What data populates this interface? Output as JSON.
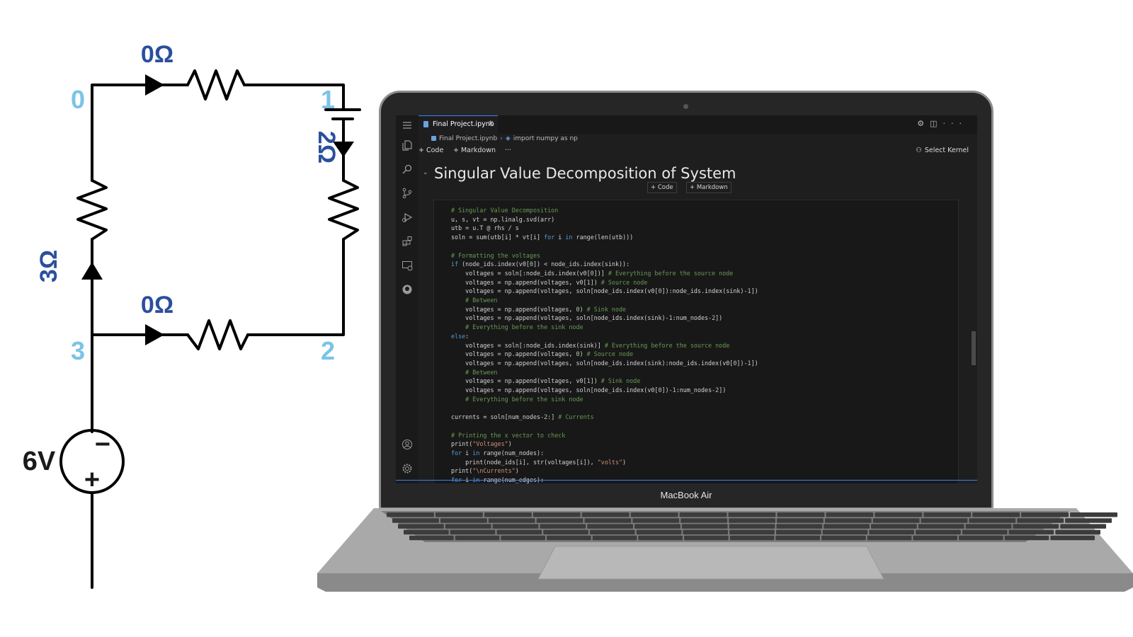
{
  "circuit": {
    "nodes": [
      "0",
      "1",
      "2",
      "3"
    ],
    "resistors": [
      "0Ω",
      "2Ω",
      "0Ω",
      "3Ω"
    ],
    "source": "6V",
    "source_minus": "−",
    "source_plus": "+"
  },
  "laptop": {
    "brand_label": "MacBook Air"
  },
  "editor": {
    "tab": {
      "label": "Final Project.ipynb",
      "close": "×"
    },
    "topright_icons": [
      "gear-icon",
      "split-editor-icon",
      "more-icon"
    ],
    "breadcrumb": {
      "file": "Final Project.ipynb",
      "symbol": "import numpy as np"
    },
    "toolbar": {
      "add_code": "+ Code",
      "add_markdown": "+ Markdown",
      "more": "···",
      "select_kernel": "Select Kernel"
    },
    "markdown_heading": "Singular Value Decomposition of System",
    "cell_toolbar": {
      "code": "+ Code",
      "markdown": "+ Markdown"
    },
    "activity_icons": [
      "menu-icon",
      "explorer-icon",
      "search-icon",
      "source-control-icon",
      "run-debug-icon",
      "extensions-icon",
      "remote-explorer-icon",
      "github-icon",
      "account-icon",
      "settings-gear-icon"
    ],
    "code_lines": [
      "# Singular Value Decomposition",
      "u, s, vt = np.linalg.svd(arr)",
      "utb = u.T @ rhs / s",
      "soln = sum(utb[i] * vt[i] for i in range(len(utb)))",
      "",
      "# Formatting the voltages",
      "if (node_ids.index(v0[0]) < node_ids.index(sink)):",
      "    voltages = soln[:node_ids.index(v0[0])] # Everything before the source node",
      "    voltages = np.append(voltages, v0[1]) # Source node",
      "    voltages = np.append(voltages, soln[node_ids.index(v0[0]):node_ids.index(sink)-1])",
      "    # Between",
      "    voltages = np.append(voltages, 0) # Sink node",
      "    voltages = np.append(voltages, soln[node_ids.index(sink)-1:num_nodes-2])",
      "    # Everything before the sink node",
      "else:",
      "    voltages = soln[:node_ids.index(sink)] # Everything before the source node",
      "    voltages = np.append(voltages, 0) # Source node",
      "    voltages = np.append(voltages, soln[node_ids.index(sink):node_ids.index(v0[0])-1])",
      "    # Between",
      "    voltages = np.append(voltages, v0[1]) # Sink node",
      "    voltages = np.append(voltages, soln[node_ids.index(v0[0])-1:num_nodes-2])",
      "    # Everything before the sink node",
      "",
      "currents = soln[num_nodes-2:] # Currents",
      "",
      "# Printing the x vector to check",
      "print(\"Voltages\")",
      "for i in range(num_nodes):",
      "    print(node_ids[i], str(voltages[i]), \"volts\")",
      "print(\"\\nCurrents\")",
      "for i in range(num_edges):"
    ]
  }
}
